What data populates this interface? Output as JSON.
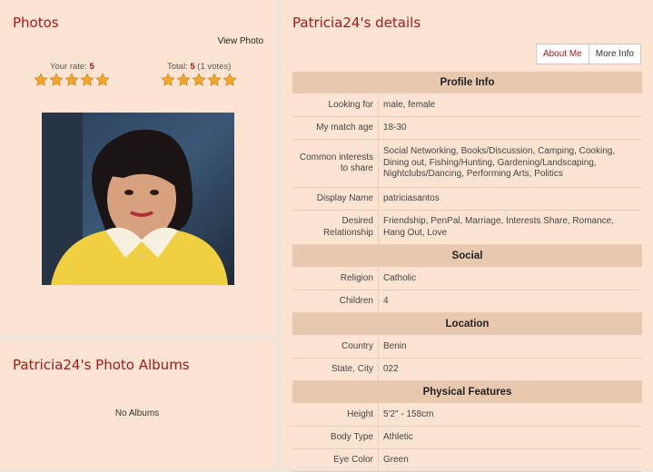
{
  "photos": {
    "title": "Photos",
    "view_photo": "View Photo",
    "your_rate_label": "Your rate:",
    "your_rate_value": "5",
    "total_label": "Total:",
    "total_value": "5",
    "total_votes": "(1 votes)",
    "your_rating_stars": 5,
    "total_rating_stars": 5
  },
  "albums": {
    "title": "Patricia24's Photo Albums",
    "empty_text": "No Albums"
  },
  "details": {
    "title": "Patricia24's details",
    "tabs": [
      "About Me",
      "More Info"
    ],
    "sections": [
      {
        "name": "Profile Info",
        "rows": [
          {
            "label": "Looking for",
            "value": "male, female"
          },
          {
            "label": "My match age",
            "value": "18-30"
          },
          {
            "label": "Common interests to share",
            "value": "Social Networking, Books/Discussion, Camping, Cooking, Dining out, Fishing/Hunting, Gardening/Landscaping, Nightclubs/Dancing, Performing Arts, Politics"
          },
          {
            "label": "Display Name",
            "value": "patriciasantos"
          },
          {
            "label": "Desired Relationship",
            "value": "Friendship, PenPal, Marriage, Interests Share, Romance, Hang Out, Love"
          }
        ]
      },
      {
        "name": "Social",
        "rows": [
          {
            "label": "Religion",
            "value": "Catholic"
          },
          {
            "label": "Children",
            "value": "4"
          }
        ]
      },
      {
        "name": "Location",
        "rows": [
          {
            "label": "Country",
            "value": "Benin"
          },
          {
            "label": "State, City",
            "value": "022"
          }
        ]
      },
      {
        "name": "Physical Features",
        "rows": [
          {
            "label": "Height",
            "value": "5'2\" - 158cm"
          },
          {
            "label": "Body Type",
            "value": "Athletic"
          },
          {
            "label": "Eye Color",
            "value": "Green"
          }
        ]
      }
    ]
  },
  "colors": {
    "accent": "#a21b1b",
    "panel_bg": "#fde4d2",
    "section_header_bg": "#e8c8ae",
    "star_fill": "#f5a623"
  }
}
